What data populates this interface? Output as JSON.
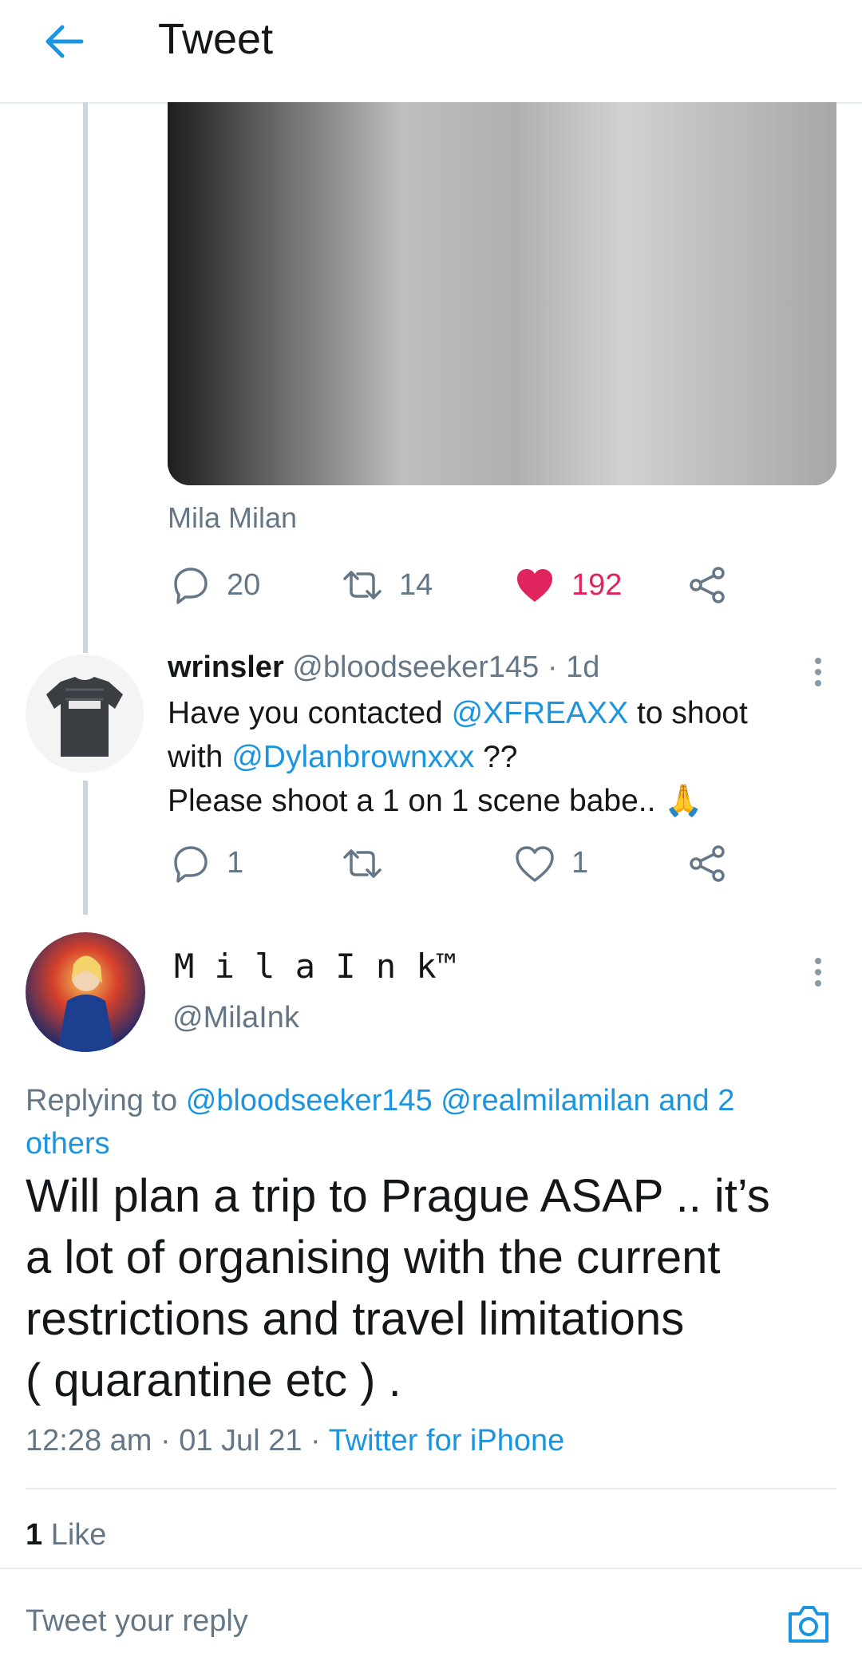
{
  "header": {
    "title": "Tweet"
  },
  "parent_tweet": {
    "caption": "Mila Milan",
    "actions": {
      "replies": "20",
      "retweets": "14",
      "likes": "192",
      "liked": true
    }
  },
  "reply_tweet": {
    "display_name": "wrinsler",
    "handle": "@bloodseeker145",
    "sep": "·",
    "time": "1d",
    "line1_pre": "Have you contacted ",
    "mention1": "@XFREAXX",
    "line1_post": " to shoot",
    "line2_pre": "with ",
    "mention2": "@Dylanbrownxxx",
    "line2_post": " ??",
    "line3": "Please shoot a 1 on 1 scene babe..",
    "emoji": "🙏",
    "actions": {
      "replies": "1",
      "retweets": "",
      "likes": "1"
    }
  },
  "main_tweet": {
    "display_name": "M i l a I n k™",
    "handle": "@MilaInk",
    "replying_label": "Replying to",
    "replying_mentions": "@bloodseeker145 @realmilamilan and 2",
    "replying_mentions_2": "others",
    "text_lines": [
      "Will plan a trip to Prague ASAP .. it’s",
      "a lot of organising with the current",
      "restrictions and travel limitations",
      "( quarantine etc ) ."
    ],
    "time": "12:28 am",
    "sep": "·",
    "date": "01 Jul 21",
    "source": "Twitter for iPhone",
    "likes_count": "1",
    "likes_label": "Like"
  },
  "composer": {
    "placeholder": "Tweet your reply"
  },
  "colors": {
    "accent": "#1b95e0",
    "like": "#e0245e",
    "muted": "#657786"
  }
}
